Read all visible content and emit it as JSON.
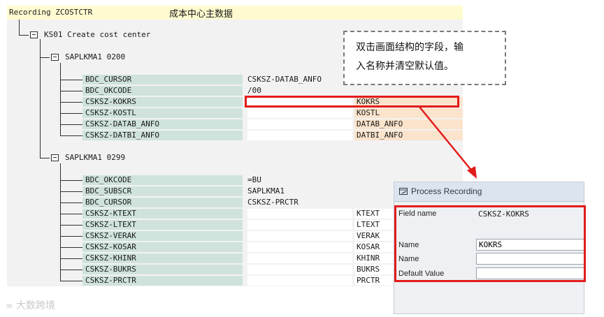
{
  "header": {
    "left": "Recording ZCOSTCTR",
    "right": "成本中心主数据"
  },
  "tree": {
    "root": "KS01 Create cost center",
    "screens": [
      {
        "label": "SAPLKMA1 0200",
        "rows": [
          {
            "field": "BDC_CURSOR",
            "value": "CSKSZ-DATAB_ANFO",
            "kw": ""
          },
          {
            "field": "BDC_OKCODE",
            "value": "/00",
            "kw": ""
          },
          {
            "field": "CSKSZ-KOKRS",
            "value": "",
            "kw": "KOKRS"
          },
          {
            "field": "CSKSZ-KOSTL",
            "value": "",
            "kw": "KOSTL"
          },
          {
            "field": "CSKSZ-DATAB_ANFO",
            "value": "",
            "kw": "DATAB_ANFO"
          },
          {
            "field": "CSKSZ-DATBI_ANFO",
            "value": "",
            "kw": "DATBI_ANFO"
          }
        ]
      },
      {
        "label": "SAPLKMA1 0299",
        "rows": [
          {
            "field": "BDC_OKCODE",
            "value": "=BU",
            "kw": ""
          },
          {
            "field": "BDC_SUBSCR",
            "value": "SAPLKMA1",
            "kw": ""
          },
          {
            "field": "BDC_CURSOR",
            "value": "CSKSZ-PRCTR",
            "kw": ""
          },
          {
            "field": "CSKSZ-KTEXT",
            "value": "",
            "kw": "KTEXT"
          },
          {
            "field": "CSKSZ-LTEXT",
            "value": "",
            "kw": "LTEXT"
          },
          {
            "field": "CSKSZ-VERAK",
            "value": "",
            "kw": "VERAK"
          },
          {
            "field": "CSKSZ-KOSAR",
            "value": "",
            "kw": "KOSAR"
          },
          {
            "field": "CSKSZ-KHINR",
            "value": "",
            "kw": "KHINR"
          },
          {
            "field": "CSKSZ-BUKRS",
            "value": "",
            "kw": "BUKRS"
          },
          {
            "field": "CSKSZ-PRCTR",
            "value": "",
            "kw": "PRCTR"
          }
        ]
      }
    ]
  },
  "callout": {
    "line1": "双击画面结构的字段，输",
    "line2": "入名称并清空默认值。"
  },
  "dialog": {
    "title": "Process Recording",
    "field_name_label": "Field name",
    "field_name_value": "CSKSZ-KOKRS",
    "name_label": "Name",
    "name_value": "KOKRS",
    "name2_label": "Name",
    "name2_value": "",
    "default_label": "Default Value",
    "default_value": ""
  },
  "watermark": "大数跨境",
  "colors": {
    "highlight": "#e31b1b",
    "field_bg": "#cfe3dc",
    "keyword_bg": "#fbe3cc",
    "header_bg": "#fffbd0"
  }
}
